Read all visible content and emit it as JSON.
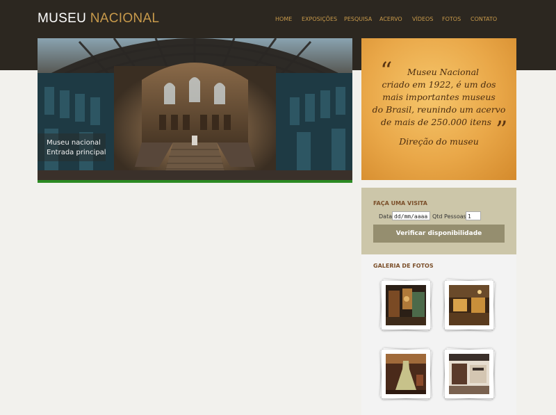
{
  "header": {
    "logo_part1": "MUSEU",
    "logo_part2": "NACIONAL",
    "nav": [
      "HOME",
      "EXPOSIÇÕES",
      "PESQUISA",
      "ACERVO",
      "VÍDEOS",
      "FOTOS",
      "CONTATO"
    ]
  },
  "hero": {
    "caption_line1": "Museu nacional",
    "caption_line2": "Entrada principal"
  },
  "quote": {
    "lines": [
      "Museu Nacional",
      "criado em 1922, é um dos",
      "mais importantes museus",
      "do Brasil, reunindo um acervo",
      "de mais de 250.000 itens"
    ],
    "author": "Direção do museu",
    "open_mark": "“",
    "close_mark": "”"
  },
  "visit": {
    "title": "FAÇA UMA VISITA",
    "date_label": "Data",
    "date_placeholder": "dd/mm/aaaa",
    "people_label": "Qtd Pessoas",
    "people_value": "1",
    "button_label": "Verificar disponibilidade"
  },
  "gallery": {
    "title": "GALERIA DE FOTOS"
  },
  "colors": {
    "header_bg": "#2c2720",
    "accent": "#c89a4b",
    "green_bar": "#2c8a23",
    "visit_bg": "#ccc6a9",
    "button_bg": "#958e6f"
  }
}
